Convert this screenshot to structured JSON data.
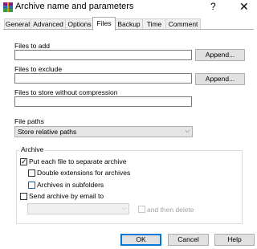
{
  "window": {
    "title": "Archive name and parameters",
    "help_glyph": "?",
    "close_glyph": "✕"
  },
  "tabs": [
    "General",
    "Advanced",
    "Options",
    "Files",
    "Backup",
    "Time",
    "Comment"
  ],
  "active_tab": "Files",
  "files_to_add": {
    "label": "Files to add",
    "value": "",
    "button": "Append..."
  },
  "files_to_exclude": {
    "label": "Files to exclude",
    "value": "",
    "button": "Append..."
  },
  "files_no_compress": {
    "label": "Files to store without compression",
    "value": ""
  },
  "file_paths": {
    "label": "File paths",
    "selected": "Store relative paths"
  },
  "archive_group": {
    "legend": "Archive",
    "put_each_file": {
      "label": "Put each file to separate archive",
      "checked": true
    },
    "double_extensions": {
      "label": "Double extensions for archives",
      "checked": false
    },
    "archives_in_subfolders": {
      "label": "Archives in subfolders",
      "checked": false
    },
    "send_by_email": {
      "label": "Send archive by email to",
      "checked": false
    },
    "email_value": "",
    "and_then_delete": {
      "label": "and then delete",
      "checked": false,
      "enabled": false
    }
  },
  "buttons": {
    "ok": "OK",
    "cancel": "Cancel",
    "help": "Help"
  },
  "icons": {
    "app": "winrar-archive-icon",
    "checkmark": "✓",
    "chevron": "⌵"
  },
  "colors": {
    "focus_blue": "#0078d7",
    "checkbox_blue": "#1a5fb4"
  }
}
